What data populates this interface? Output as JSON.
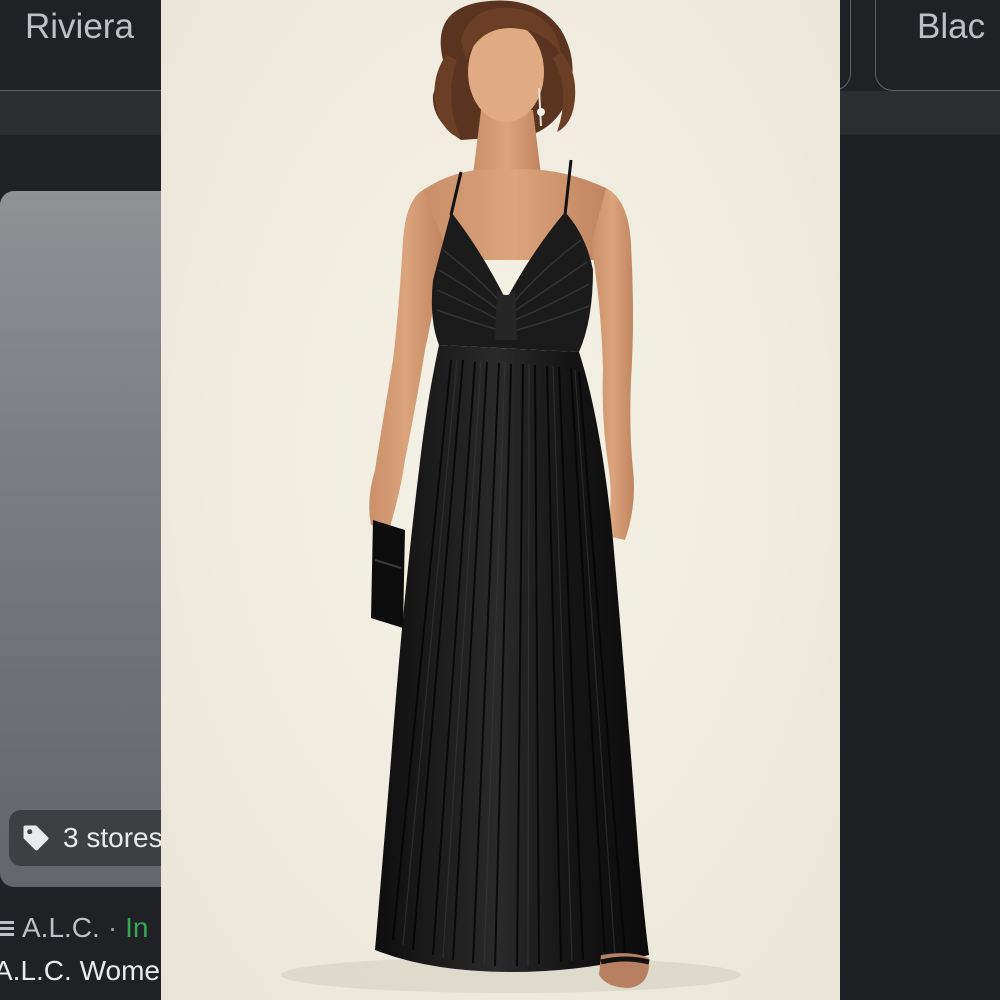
{
  "filter_chips": {
    "left_label": "Riviera",
    "right_label": "Blac"
  },
  "result_card": {
    "stores_badge": "3 stores",
    "seller": "A.L.C.",
    "separator": "·",
    "status": "In",
    "title": "A.L.C. Wome"
  },
  "icons": {
    "tag": "tag-icon",
    "seller": "store-lines-icon"
  },
  "colors": {
    "background": "#202124",
    "chip_border": "#5f6368",
    "badge_bg": "#3c4043",
    "status_green": "#34a853",
    "photo_bg": "#efebde",
    "dress": "#141414"
  }
}
